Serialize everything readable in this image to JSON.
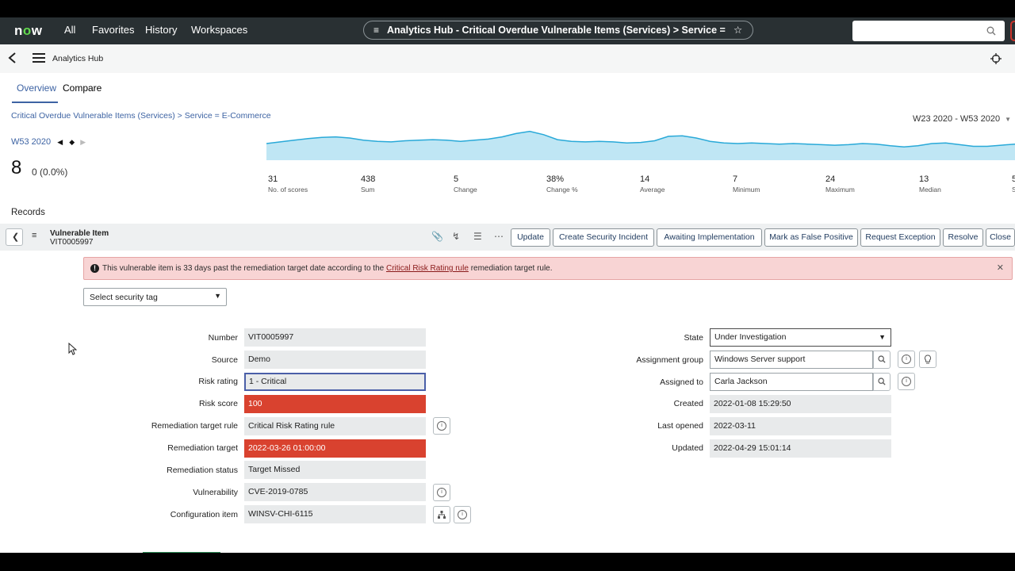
{
  "nav": {
    "logo": "now",
    "links": [
      "All",
      "Favorites",
      "History",
      "Workspaces"
    ],
    "context_pill": "Analytics Hub - Critical Overdue Vulnerable Items (Services) > Service = E-Comm...",
    "search_value": ""
  },
  "header": {
    "title": "Analytics Hub"
  },
  "tabs": [
    "Overview",
    "Compare"
  ],
  "breadcrumb": "Critical Overdue Vulnerable Items (Services) > Service = E-Commerce",
  "date_range": "W23 2020 - W53 2020",
  "period": "W53 2020",
  "score": {
    "value": "8",
    "change": "0 (0.0%)"
  },
  "trend_series": [
    30,
    33,
    36,
    39,
    41,
    42,
    40,
    36,
    34,
    33,
    35,
    36,
    37,
    36,
    34,
    36,
    38,
    42,
    48,
    52,
    46,
    37,
    34,
    33,
    34,
    33,
    31,
    32,
    35,
    43,
    44,
    40,
    34,
    31,
    30,
    31,
    30,
    29,
    30,
    29,
    28,
    27,
    28,
    30,
    29,
    26,
    24,
    26,
    30,
    31,
    28,
    25,
    25,
    27,
    29
  ],
  "stats": [
    {
      "value": "31",
      "label": "No. of scores"
    },
    {
      "value": "438",
      "label": "Sum"
    },
    {
      "value": "5",
      "label": "Change"
    },
    {
      "value": "38%",
      "label": "Change %"
    },
    {
      "value": "14",
      "label": "Average"
    },
    {
      "value": "7",
      "label": "Minimum"
    },
    {
      "value": "24",
      "label": "Maximum"
    },
    {
      "value": "13",
      "label": "Median"
    },
    {
      "value": "5",
      "label": "S"
    }
  ],
  "records_label": "Records",
  "record": {
    "type": "Vulnerable Item",
    "number": "VIT0005997",
    "actions": [
      "Update",
      "Create Security Incident",
      "Awaiting Implementation",
      "Mark as False Positive",
      "Request Exception",
      "Resolve",
      "Close"
    ]
  },
  "alert": {
    "prefix": "This vulnerable item is 33 days past the remediation target date according to the",
    "link": "Critical Risk Rating rule",
    "suffix": "remediation target rule."
  },
  "security_tag": "Select security tag",
  "form_left": [
    {
      "label": "Number",
      "value": "VIT0005997"
    },
    {
      "label": "Source",
      "value": "Demo"
    },
    {
      "label": "Risk rating",
      "value": "1 - Critical"
    },
    {
      "label": "Risk score",
      "value": "100"
    },
    {
      "label": "Remediation target rule",
      "value": "Critical Risk Rating rule"
    },
    {
      "label": "Remediation target",
      "value": "2022-03-26 01:00:00"
    },
    {
      "label": "Remediation status",
      "value": "Target Missed"
    },
    {
      "label": "Vulnerability",
      "value": "CVE-2019-0785"
    },
    {
      "label": "Configuration item",
      "value": "WINSV-CHI-6115"
    }
  ],
  "form_right": [
    {
      "label": "State",
      "value": "Under Investigation"
    },
    {
      "label": "Assignment group",
      "value": "Windows Server support"
    },
    {
      "label": "Assigned to",
      "value": "Carla Jackson"
    },
    {
      "label": "Created",
      "value": "2022-01-08 15:29:50"
    },
    {
      "label": "Last opened",
      "value": "2022-03-11"
    },
    {
      "label": "Updated",
      "value": "2022-04-29 15:01:14"
    }
  ],
  "colors": {
    "nav_bg": "#293033",
    "accent": "#3d63a3",
    "critical": "#d9422f",
    "alert_bg": "#f8d4d4",
    "spark": "#29a9d8"
  }
}
